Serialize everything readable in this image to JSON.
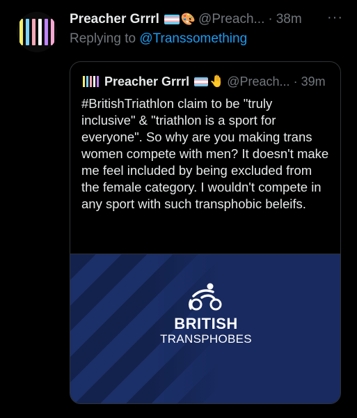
{
  "tweet": {
    "author_name": "Preacher Grrrl",
    "author_emoji": "🎨",
    "handle": "@Preach...",
    "separator": "·",
    "time": "38m",
    "more": "···",
    "reply_prefix": "Replying to ",
    "reply_mention": "@Transsomething"
  },
  "quote": {
    "author_name": "Preacher Grrrl",
    "author_emoji": "🤚",
    "handle": "@Preach...",
    "separator": "·",
    "time": "39m",
    "text": "#BritishTriathlon claim to be \"truly inclusive\" & \"triathlon is a sport for everyone\". So why are you making trans women compete with men? It doesn't make me feel included by being excluded from the female category. I wouldn't compete in any sport with such transphobic beleifs.",
    "media": {
      "logo_line1": "BRITISH",
      "logo_line2": "TRANSPHOBES"
    }
  },
  "colors": {
    "background": "#000000",
    "link": "#1d9bf0",
    "muted": "#71767b",
    "media_bg": "#182a5f",
    "avatar_bars": [
      "#f2ee6d",
      "#7dd3fc",
      "#f5abb9",
      "#ffffff",
      "#c084fc",
      "#f9a8d4"
    ]
  }
}
